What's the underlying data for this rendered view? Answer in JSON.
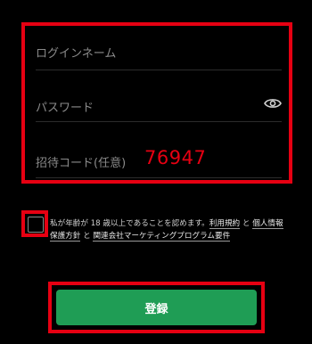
{
  "form": {
    "login_placeholder": "ログインネーム",
    "password_placeholder": "パスワード",
    "invite_label": "招待コード(任意)",
    "invite_value": "76947"
  },
  "terms": {
    "prefix": "私が年齢が 18 歳以上であることを認めます。",
    "link_terms": "利用規約",
    "and_1": " と ",
    "link_privacy": "個人情報保護方針",
    "and_2": " と ",
    "link_marketing": "関連会社マーケティングプログラム要件"
  },
  "register_button": {
    "label": "登録"
  },
  "colors": {
    "highlight": "#e60012",
    "button": "#1f9d55",
    "background": "#000000"
  },
  "icons": {
    "password_toggle": "eye-icon"
  }
}
